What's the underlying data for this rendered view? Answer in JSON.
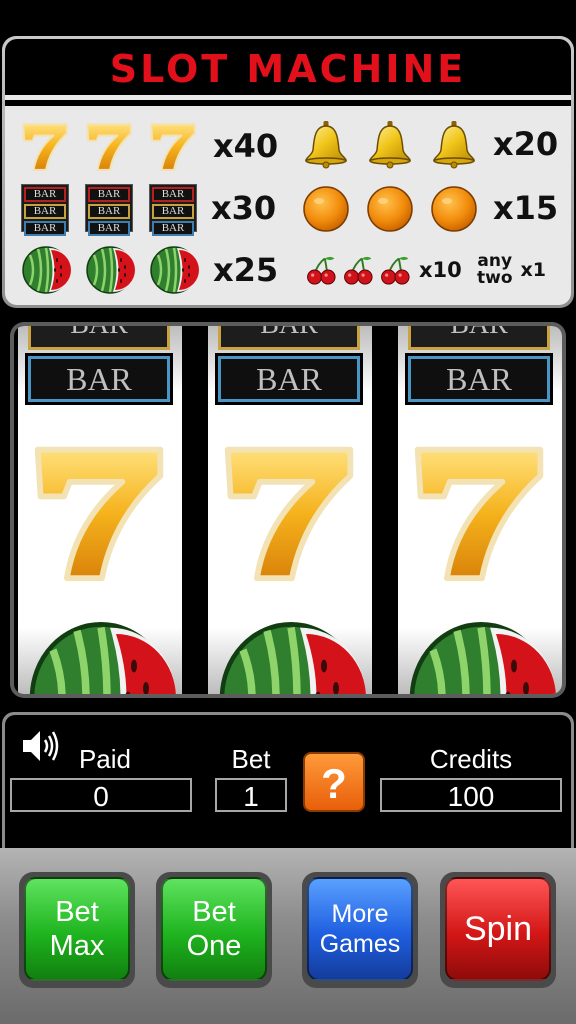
{
  "header": {
    "title": "SLOT MACHINE"
  },
  "paytable": {
    "rows": [
      {
        "symbol": "seven-icon",
        "count": 3,
        "payout": "x40"
      },
      {
        "symbol": "bell-icon",
        "count": 3,
        "payout": "x20"
      },
      {
        "symbol": "bar-icon",
        "count": 3,
        "payout": "x30",
        "bar_label": "BAR"
      },
      {
        "symbol": "orange-icon",
        "count": 3,
        "payout": "x15"
      },
      {
        "symbol": "watermelon-icon",
        "count": 3,
        "payout": "x25"
      },
      {
        "symbol": "cherry-icon",
        "count": 3,
        "payout": "x10"
      },
      {
        "symbol": "any-two",
        "count": 2,
        "payout": "x1",
        "label_line1": "any",
        "label_line2": "two"
      }
    ]
  },
  "reels": {
    "bar_label": "BAR",
    "visible": [
      [
        "bar-icon",
        "seven-icon",
        "watermelon-icon"
      ],
      [
        "bar-icon",
        "seven-icon",
        "watermelon-icon"
      ],
      [
        "bar-icon",
        "seven-icon",
        "watermelon-icon"
      ]
    ]
  },
  "info": {
    "paid_label": "Paid",
    "paid_value": "0",
    "bet_label": "Bet",
    "bet_value": "1",
    "credits_label": "Credits",
    "credits_value": "100",
    "help_label": "?",
    "sound_icon": "speaker-icon"
  },
  "buttons": {
    "bet_max": {
      "line1": "Bet",
      "line2": "Max"
    },
    "bet_one": {
      "line1": "Bet",
      "line2": "One"
    },
    "more_games": {
      "line1": "More",
      "line2": "Games"
    },
    "spin": {
      "label": "Spin"
    }
  },
  "colors": {
    "title_red": "#e2101a",
    "bet_green": "#1fb41f",
    "more_games_blue": "#1f5fe0",
    "spin_red": "#d31616",
    "help_orange": "#f07a1c"
  }
}
